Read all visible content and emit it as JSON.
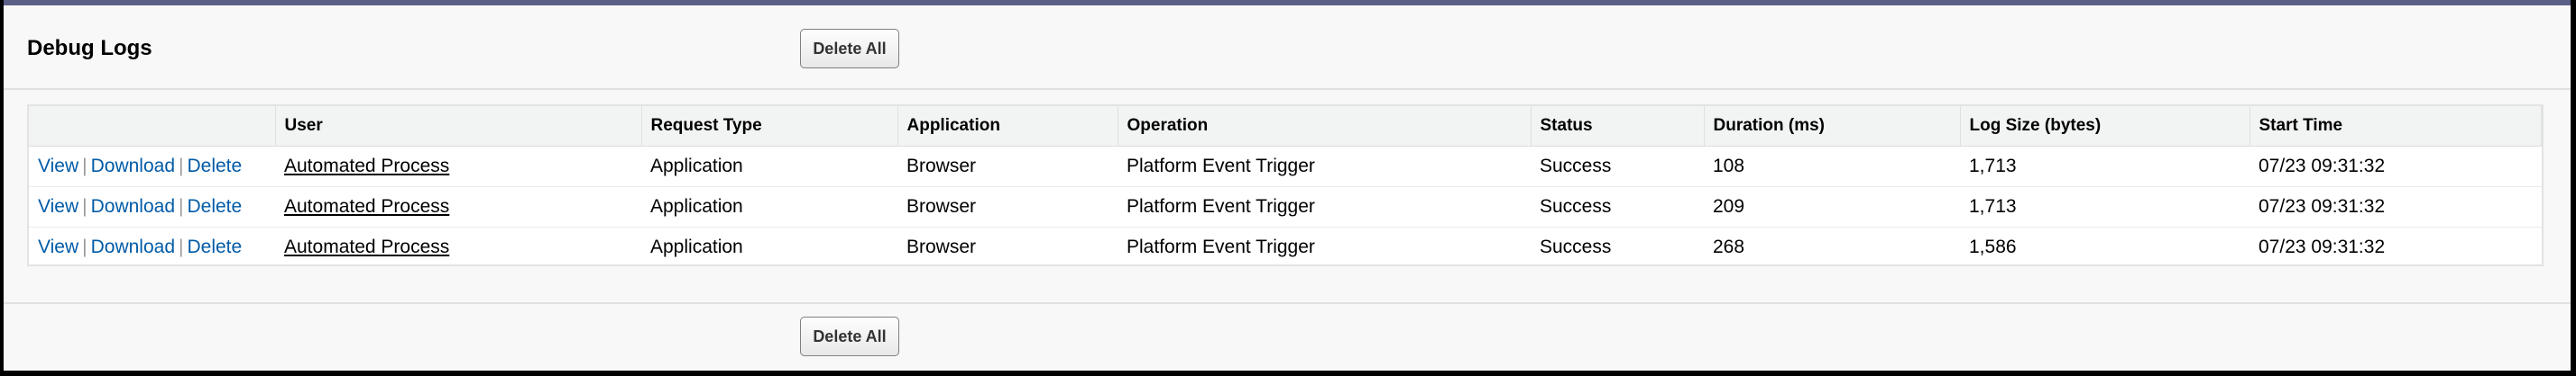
{
  "header": {
    "title": "Debug Logs",
    "delete_all_label": "Delete All"
  },
  "footer": {
    "delete_all_label": "Delete All"
  },
  "table": {
    "columns": [
      "",
      "User",
      "Request Type",
      "Application",
      "Operation",
      "Status",
      "Duration (ms)",
      "Log Size (bytes)",
      "Start Time"
    ],
    "action_labels": {
      "view": "View",
      "download": "Download",
      "delete": "Delete",
      "separator": "|"
    },
    "rows": [
      {
        "user": "Automated Process",
        "request_type": "Application",
        "application": "Browser",
        "operation": "Platform Event Trigger",
        "status": "Success",
        "duration": "108",
        "log_size": "1,713",
        "start_time": "07/23 09:31:32"
      },
      {
        "user": "Automated Process",
        "request_type": "Application",
        "application": "Browser",
        "operation": "Platform Event Trigger",
        "status": "Success",
        "duration": "209",
        "log_size": "1,713",
        "start_time": "07/23 09:31:32"
      },
      {
        "user": "Automated Process",
        "request_type": "Application",
        "application": "Browser",
        "operation": "Platform Event Trigger",
        "status": "Success",
        "duration": "268",
        "log_size": "1,586",
        "start_time": "07/23 09:31:32"
      }
    ]
  }
}
